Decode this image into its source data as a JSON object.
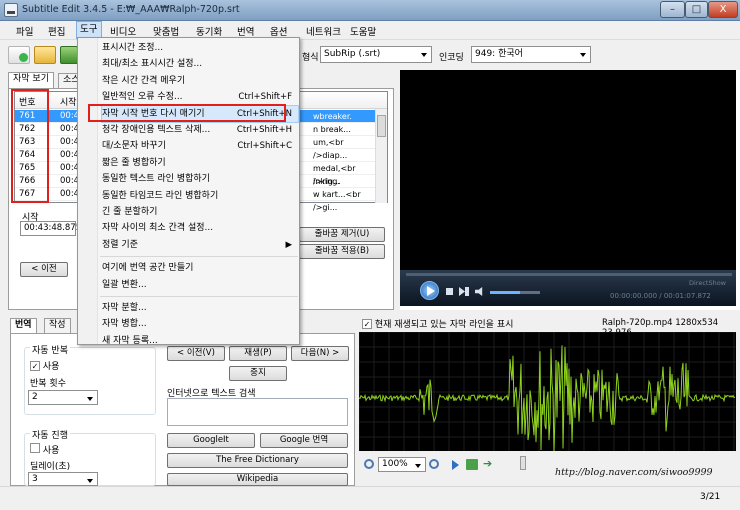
{
  "window": {
    "title": "Subtitle Edit 3.4.5 - E:₩_AAA₩Ralph-720p.srt",
    "min": "–",
    "max": "□",
    "close": "X"
  },
  "menubar": [
    "파일",
    "편집",
    "도구",
    "비디오",
    "맞춤법",
    "동기화",
    "번역",
    "옵션",
    "네트워크",
    "도움말"
  ],
  "toolbar": {
    "format_label": "형식",
    "format_value": "SubRip (.srt)",
    "encoding_label": "인코딩",
    "encoding_value": "949: 한국어"
  },
  "tabs": {
    "view": "자막 보기",
    "source": "소스"
  },
  "subtitle_grid": {
    "headers": {
      "num": "번호",
      "start": "시작"
    },
    "rows": [
      {
        "num": "761",
        "start": "00:4",
        "text": "wbreaker."
      },
      {
        "num": "762",
        "start": "00:4",
        "text": "n break..."
      },
      {
        "num": "763",
        "start": "00:4",
        "text": "um,<br />diap..."
      },
      {
        "num": "764",
        "start": "00:4",
        "text": ""
      },
      {
        "num": "765",
        "start": "00:4",
        "text": "medal,<br />rig..."
      },
      {
        "num": "766",
        "start": "00:4",
        "text": "inking."
      },
      {
        "num": "767",
        "start": "00:4",
        "text": "w kart...<br />gi..."
      }
    ]
  },
  "editor": {
    "start_label": "시작",
    "start_value": "00:43:48.875",
    "prev_button": "< 이전",
    "remove_lb_button": "줄바꿈 제거(U)",
    "apply_lb_button": "줄바꿈 적용(B)"
  },
  "tools_menu": {
    "items": [
      {
        "label": "표시시간 조정...",
        "shortcut": ""
      },
      {
        "label": "최대/최소 표시시간 설정...",
        "shortcut": ""
      },
      {
        "label": "작은 시간 간격 메우기",
        "shortcut": ""
      },
      {
        "label": "일반적인 오류 수정...",
        "shortcut": "Ctrl+Shift+F"
      },
      {
        "label": "자막 시작 번호 다시 매기기",
        "shortcut": "Ctrl+Shift+N"
      },
      {
        "label": "청각 장애인용 텍스트 삭제...",
        "shortcut": "Ctrl+Shift+H"
      },
      {
        "label": "대/소문자 바꾸기",
        "shortcut": "Ctrl+Shift+C"
      },
      {
        "label": "짧은 줄 병합하기",
        "shortcut": ""
      },
      {
        "label": "동일한 텍스트 라인 병합하기",
        "shortcut": ""
      },
      {
        "label": "동일한 타임코드 라인 병합하기",
        "shortcut": ""
      },
      {
        "label": "긴 줄 분할하기",
        "shortcut": ""
      },
      {
        "label": "자막 사이의 최소 간격 설정...",
        "shortcut": ""
      },
      {
        "label": "정렬 기준",
        "shortcut": "▶"
      },
      {
        "label": "여기에 번역 공간 만들기",
        "shortcut": ""
      },
      {
        "label": "일괄 변환...",
        "shortcut": ""
      },
      {
        "label": "자막 분할...",
        "shortcut": ""
      },
      {
        "label": "자막 병합...",
        "shortcut": ""
      },
      {
        "label": "새 자막 등록...",
        "shortcut": ""
      }
    ]
  },
  "bottom_tabs": {
    "translate": "번역",
    "create": "작성"
  },
  "auto_repeat": {
    "title": "자동 반복",
    "use": "사용",
    "count_label": "반복 횟수",
    "count_value": "2"
  },
  "auto_continue": {
    "title": "자동 진행",
    "use": "사용",
    "delay_label": "딜레이(초)",
    "delay_value": "3"
  },
  "playback": {
    "prev": "< 이전(V)",
    "play": "재생(P)",
    "next": "다음(N) >",
    "stop": "중지"
  },
  "search": {
    "label": "인터넷으로 텍스트 검색",
    "google_it": "GoogleIt",
    "google_translate": "Google 번역",
    "free_dict": "The Free Dictionary",
    "wikipedia": "Wikipedia"
  },
  "video": {
    "time": "00:00:00.000 / 00:01:07.872",
    "brand": "DirectShow"
  },
  "wave": {
    "checkbox_label": "현재 재생되고 있는 자막 라인을 표시",
    "file_info": "Ralph-720p.mp4 1280x534  23.976",
    "zoom": "100%"
  },
  "watermark": "http://blog.naver.com/siwoo9999",
  "status": {
    "page": "3/21"
  },
  "colors": {
    "selection": "#3399ff",
    "highlight_box": "#e0201a",
    "wave": "#8fd21e"
  }
}
